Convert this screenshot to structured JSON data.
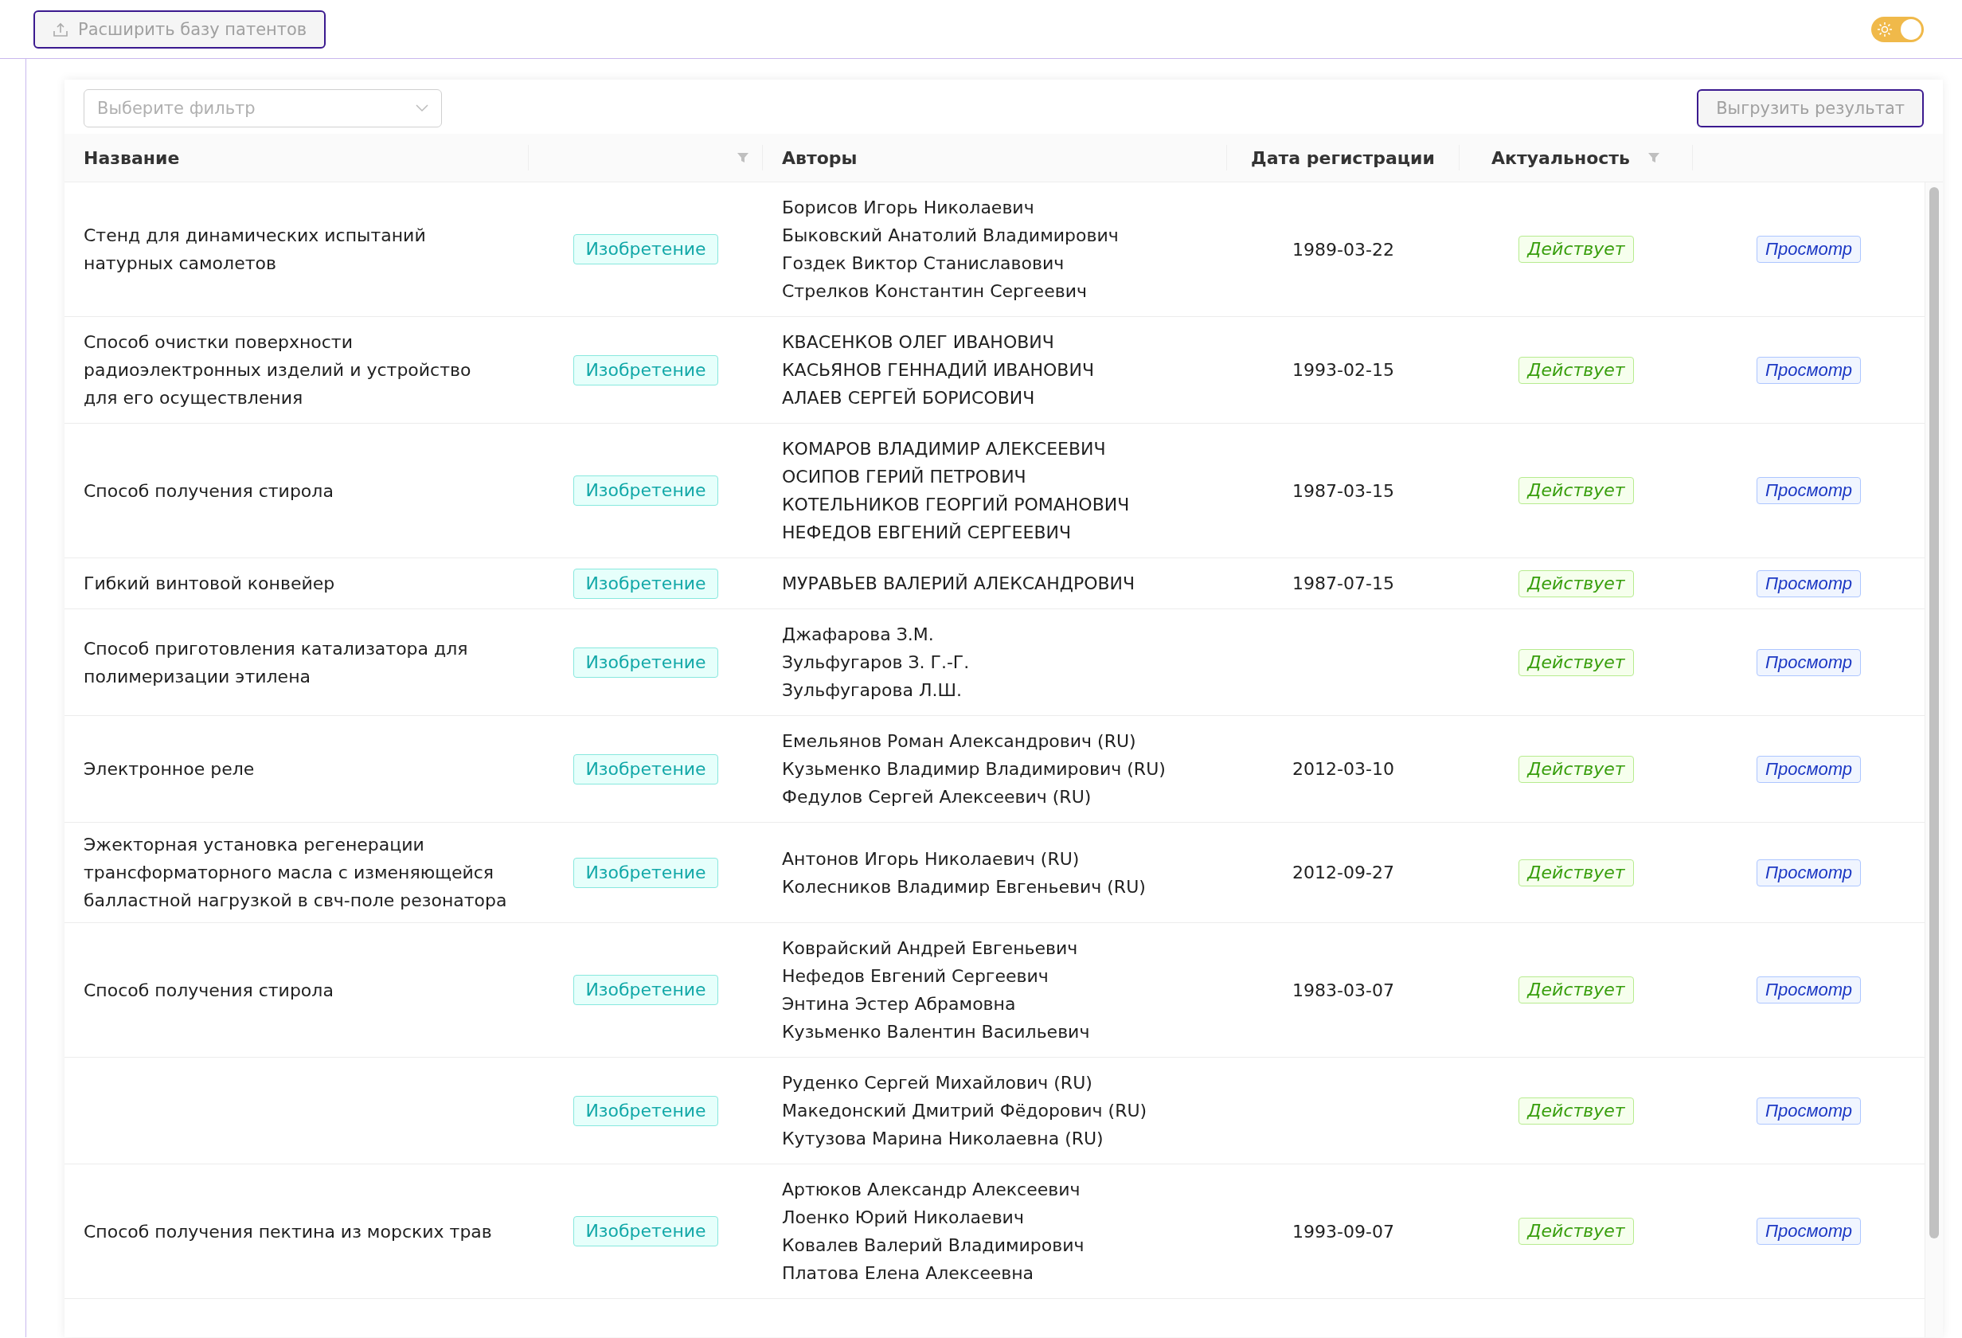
{
  "topbar": {
    "expand_button": "Расширить базу патентов",
    "theme_toggle": {
      "on": true
    }
  },
  "filter": {
    "placeholder": "Выберите фильтр"
  },
  "export_button": "Выгрузить результат",
  "table": {
    "columns": [
      {
        "label": "Название",
        "filter": false
      },
      {
        "filter": true
      },
      {
        "label": "Авторы",
        "filter": false
      },
      {
        "label": "Дата регистрации",
        "filter": false
      },
      {
        "label": "Актуальность",
        "filter": true
      },
      {
        "filter": false
      }
    ],
    "rows": [
      {
        "title": "Стенд для динамических испытаний натурных самолетов",
        "type": "Изобретение",
        "authors": [
          "Борисов Игорь Николаевич",
          "Быковский Анатолий Владимирович",
          "Гоздек Виктор Станиславович",
          "Стрелков Константин Сергеевич"
        ],
        "date": "1989-03-22",
        "status": "Действует",
        "action": "Просмотр"
      },
      {
        "title": "Способ очистки поверхности радиоэлектронных изделий и устройство для его осуществления",
        "type": "Изобретение",
        "authors": [
          "КВАСЕНКОВ ОЛЕГ ИВАНОВИЧ",
          "КАСЬЯНОВ ГЕННАДИЙ ИВАНОВИЧ",
          "АЛАЕВ СЕРГЕЙ БОРИСОВИЧ"
        ],
        "date": "1993-02-15",
        "status": "Действует",
        "action": "Просмотр"
      },
      {
        "title": "Способ получения стирола",
        "type": "Изобретение",
        "authors": [
          "КОМАРОВ ВЛАДИМИР АЛЕКСЕЕВИЧ",
          "ОСИПОВ ГЕРИЙ ПЕТРОВИЧ",
          "КОТЕЛЬНИКОВ ГЕОРГИЙ РОМАНОВИЧ",
          "НЕФЕДОВ ЕВГЕНИЙ СЕРГЕЕВИЧ"
        ],
        "date": "1987-03-15",
        "status": "Действует",
        "action": "Просмотр"
      },
      {
        "title": "Гибкий винтовой конвейер",
        "type": "Изобретение",
        "authors": [
          "МУРАВЬЕВ ВАЛЕРИЙ АЛЕКСАНДРОВИЧ"
        ],
        "date": "1987-07-15",
        "status": "Действует",
        "action": "Просмотр"
      },
      {
        "title": "Способ приготовления катализатора для полимеризации этилена",
        "type": "Изобретение",
        "authors": [
          "Джафарова З.М.",
          "Зульфугаров З. Г.-Г.",
          "Зульфугарова Л.Ш."
        ],
        "status": "Действует",
        "action": "Просмотр"
      },
      {
        "title": "Электронное реле",
        "type": "Изобретение",
        "authors": [
          "Емельянов Роман Александрович (RU)",
          "Кузьменко Владимир Владимирович (RU)",
          "Федулов Сергей Алексеевич (RU)"
        ],
        "date": "2012-03-10",
        "status": "Действует",
        "action": "Просмотр"
      },
      {
        "title": "Эжекторная установка регенерации трансформаторного масла с изменяющейся балластной нагрузкой в свч-поле резонатора",
        "type": "Изобретение",
        "authors": [
          "Антонов Игорь Николаевич (RU)",
          "Колесников Владимир Евгеньевич (RU)"
        ],
        "date": "2012-09-27",
        "status": "Действует",
        "action": "Просмотр"
      },
      {
        "title": "Способ получения стирола",
        "type": "Изобретение",
        "authors": [
          "Коврайский Андрей Евгеньевич",
          "Нефедов Евгений Сергеевич",
          "Энтина Эстер Абрамовна",
          "Кузьменко Валентин Васильевич"
        ],
        "date": "1983-03-07",
        "status": "Действует",
        "action": "Просмотр"
      },
      {
        "type": "Изобретение",
        "authors": [
          "Руденко Сергей Михайлович (RU)",
          "Македонский Дмитрий Фёдорович (RU)",
          "Кутузова Марина Николаевна (RU)"
        ],
        "status": "Действует",
        "action": "Просмотр"
      },
      {
        "title": "Способ получения пектина из морских трав",
        "type": "Изобретение",
        "authors": [
          "Артюков Александр Алексеевич",
          "Лоенко Юрий Николаевич",
          "Ковалев Валерий Владимирович",
          "Платова Елена Алексеевна"
        ],
        "date": "1993-09-07",
        "status": "Действует",
        "action": "Просмотр"
      }
    ]
  }
}
